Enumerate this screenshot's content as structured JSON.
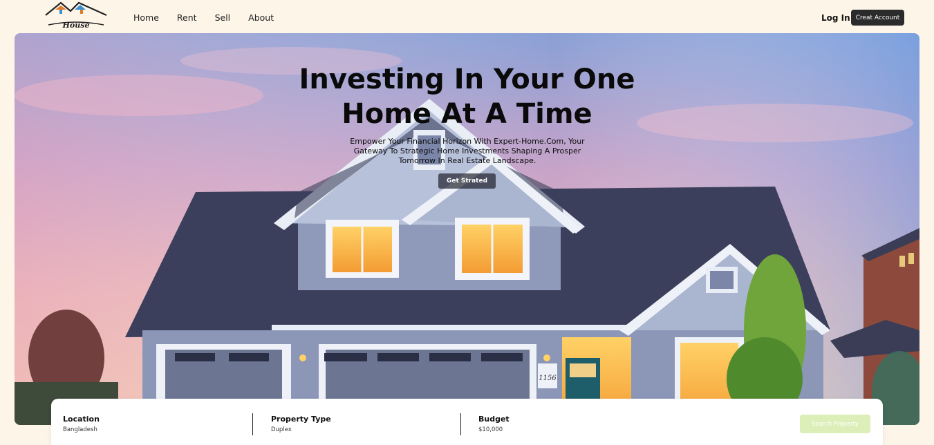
{
  "brand": {
    "logo_text": "House"
  },
  "nav": {
    "items": [
      "Home",
      "Rent",
      "Sell",
      "About"
    ]
  },
  "auth": {
    "login_label": "Log In",
    "create_label": "Creat Account"
  },
  "hero": {
    "title_line1": "Investing In Your One",
    "title_line2": "Home At A Time",
    "subtitle": "Empower Your Financial Horizon With Expert-Home.Com, Your Gateway To Strategic Home Investments Shaping A Prosper Tomorrow In Real Estate Landscape.",
    "cta_label": "Get Strated",
    "house_number": "1156"
  },
  "search": {
    "location": {
      "label": "Location",
      "value": "Bangladesh"
    },
    "property_type": {
      "label": "Property Type",
      "value": "Duplex"
    },
    "budget": {
      "label": "Budget",
      "value": "$10,000"
    },
    "button_label": "Search Property"
  },
  "colors": {
    "background": "#fdf5e8",
    "dark_button": "#2b2b2b",
    "search_button": "#dcefb8",
    "roof": "#3b3f5c",
    "siding": "#8c97b8"
  }
}
